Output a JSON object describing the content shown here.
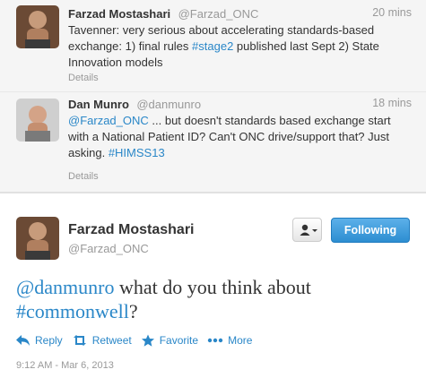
{
  "tweets": [
    {
      "name": "Farzad Mostashari",
      "handle": "@Farzad_ONC",
      "time": "20 mins",
      "text_parts": [
        "Tavenner: very serious about accelerating standards-based exchange: 1) final rules ",
        "#stage2",
        " published last Sept 2) State Innovation models"
      ],
      "details": "Details"
    },
    {
      "name": "Dan Munro",
      "handle": "@danmunro",
      "time": "18 mins",
      "text_parts": [
        "@Farzad_ONC",
        " ... but doesn't standards based exchange start with a National Patient ID? Can't ONC drive/support that? Just asking. ",
        "#HIMSS13"
      ],
      "details": "Details"
    }
  ],
  "main_tweet": {
    "name": "Farzad Mostashari",
    "handle": "@Farzad_ONC",
    "follow_label": "Following",
    "text_parts": [
      "@danmunro",
      " what do you think about ",
      "#commonwell",
      "?"
    ],
    "actions": {
      "reply": "Reply",
      "retweet": "Retweet",
      "favorite": "Favorite",
      "more": "More"
    },
    "timestamp": "9:12 AM - Mar 6, 2013"
  },
  "colors": {
    "link": "#2a87c8",
    "muted": "#999999",
    "follow_button": "#2d8ed1",
    "compact_bg": "#f5f5f5"
  },
  "icons": [
    "avatar-farzad",
    "avatar-dan",
    "user-icon",
    "caret-down-icon",
    "reply-icon",
    "retweet-icon",
    "star-icon",
    "ellipsis-icon"
  ]
}
